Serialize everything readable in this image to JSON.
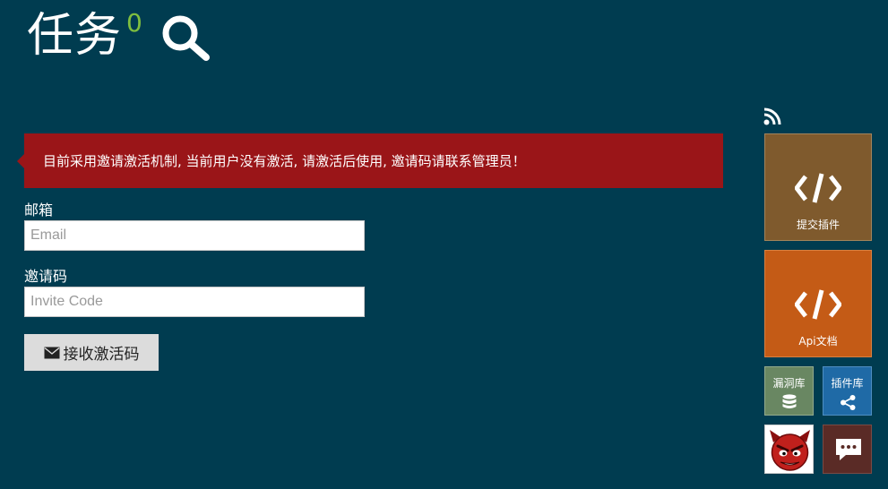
{
  "header": {
    "title": "任务",
    "task_count": "0",
    "icons": {
      "search": "search-icon"
    }
  },
  "alert": {
    "message": "目前采用邀请激活机制, 当前用户没有激活, 请激活后使用, 邀请码请联系管理员！",
    "color": "#9a1518"
  },
  "form": {
    "email": {
      "label": "邮箱",
      "placeholder": "Email",
      "value": ""
    },
    "invite": {
      "label": "邀请码",
      "placeholder": "Invite Code",
      "value": ""
    },
    "submit": {
      "label": "接收激活码",
      "icon": "envelope-icon"
    }
  },
  "sidebar": {
    "rss_icon": "rss-icon",
    "tiles": {
      "submit_plugin": {
        "label": "提交插件",
        "icon": "code-icon",
        "color": "#7f5a2d"
      },
      "api_docs": {
        "label": "Api文档",
        "icon": "code-icon",
        "color": "#c45b16"
      },
      "vuln_db": {
        "label": "漏洞库",
        "icon": "database-icon",
        "color": "#698762"
      },
      "plugin_lib": {
        "label": "插件库",
        "icon": "share-icon",
        "color": "#1f6aa6"
      },
      "user_avatar": {
        "icon": "devil-avatar-icon"
      },
      "chat": {
        "icon": "chat-icon",
        "color": "#5a2b26"
      }
    }
  },
  "colors": {
    "background": "#003c50",
    "count_accent": "#7fbf3f"
  }
}
